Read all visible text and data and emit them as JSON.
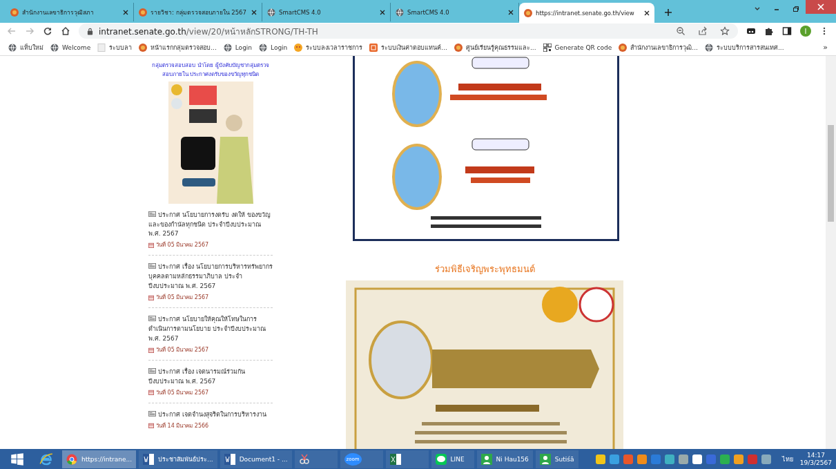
{
  "tabs": [
    {
      "title": "สำนักงานเลขาธิการวุฒิสภา",
      "selected": false
    },
    {
      "title": "รายวิชา: กลุ่มตรวจสอบภายใน 2567",
      "selected": false
    },
    {
      "title": "SmartCMS 4.0",
      "selected": false
    },
    {
      "title": "SmartCMS 4.0",
      "selected": false
    },
    {
      "title": "https://intranet.senate.go.th/view",
      "selected": true
    }
  ],
  "address": {
    "host": "intranet.senate.go.th",
    "path": "/view/20/หน้าหลักSTRONG/TH-TH"
  },
  "bookmarks": [
    "แท็บใหม่",
    "Welcome",
    "ระบบลา",
    "หน้าแรกกลุ่มตรวจสอบ...",
    "Login",
    "Login",
    "ระบบลงเวลาราชการ",
    "ระบบเงินค่าตอบแทนค์...",
    "ศูนย์เรียนรู้คุณธรรมและ...",
    "Generate QR code",
    "สำนักงานเลขาธิการวุฒิ...",
    "ระบบบริการสารสนเทศ..."
  ],
  "bookmarks_more": "»",
  "profile_initial": "I",
  "sidebar": {
    "caption": "กลุ่มตรวจสอบสอบ นำโดย ผู้บังคับบัญชากลุ่มตรวจสอบภายใน ประกาศงดรับของขวัญทุกชนิด",
    "announcements": [
      {
        "title": "ประกาศ นโยบายการงดรับ งดให้ ของขวัญและของกำนัลทุกชนิด ประจำปีงบประมาณ พ.ศ. 2567",
        "date": "วันที่ 05 มีนาคม 2567"
      },
      {
        "title": "ประกาศ เรื่อง นโยบายการบริหารทรัพยากรบุคคลตามหลักธรรมาภิบาล ประจำปีงบประมาณ พ.ศ. 2567",
        "date": "วันที่ 05 มีนาคม 2567"
      },
      {
        "title": "ประกาศ นโยบายให้คุณให้โทษในการดำเนินการตามนโยบาย ประจำปีงบประมาณ พ.ศ. 2567",
        "date": "วันที่ 05 มีนาคม 2567"
      },
      {
        "title": "ประกาศ เรื่อง เจตนารมณ์ร่วมกัน ปีงบประมาณ พ.ศ. 2567",
        "date": "วันที่ 05 มีนาคม 2567"
      },
      {
        "title": "ประกาศ เจตจำนงสุจริตในการบริหารงาน",
        "date": "วันที่ 14 มีนาคม 2566"
      }
    ]
  },
  "main": {
    "section_heading": "ร่วมพิธีเจริญพระพุทธมนต์"
  },
  "taskbar": {
    "items": [
      {
        "kind": "start"
      },
      {
        "kind": "ie"
      },
      {
        "kind": "chrome",
        "label": "https://intrane...",
        "selected": true
      },
      {
        "kind": "word",
        "label": "ประชาสัมพันธ์ประ...",
        "selected": false
      },
      {
        "kind": "word",
        "label": "Document1 - ...",
        "selected": false
      },
      {
        "kind": "snip",
        "selected": false
      },
      {
        "kind": "zoom",
        "label": "zoom",
        "selected": false
      },
      {
        "kind": "excel",
        "selected": false
      },
      {
        "kind": "line",
        "label": "LINE",
        "selected": false
      },
      {
        "kind": "contact",
        "label": "Ni Hau156",
        "selected": false
      },
      {
        "kind": "contact",
        "label": "Sutiśā",
        "selected": false
      }
    ],
    "language": "ไทย",
    "time": "14:17",
    "date": "19/3/2567"
  }
}
